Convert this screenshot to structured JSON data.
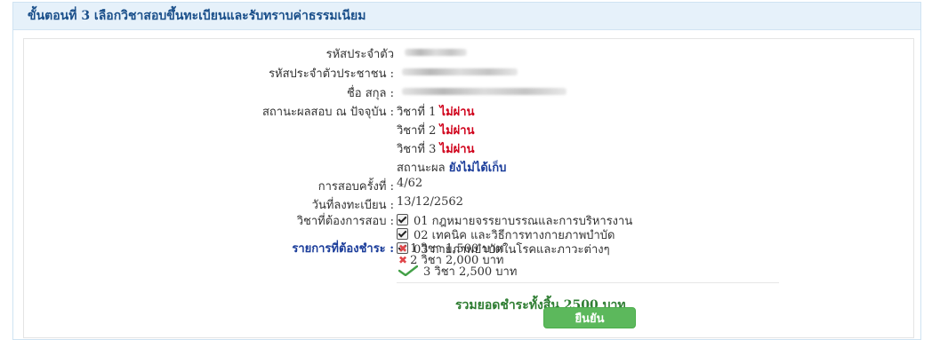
{
  "header": {
    "title": "ขั้นตอนที่ 3 เลือกวิชาสอบขึ้นทะเบียนและรับทราบค่าธรรมเนียม"
  },
  "fields": {
    "student_id_label": "รหัสประจำตัว",
    "national_id_label": "รหัสประจำตัวประชาชน :",
    "name_label": "ชื่อ สกุล :",
    "exam_status_label": "สถานะผลสอบ ณ ปัจจุบัน :",
    "subject1_prefix": "วิชาที่ 1",
    "subject1_status": "ไม่ผ่าน",
    "subject2_prefix": "วิชาที่ 2",
    "subject2_status": "ไม่ผ่าน",
    "subject3_prefix": "วิชาที่ 3",
    "subject3_status": "ไม่ผ่าน",
    "result_prefix": "สถานะผล",
    "result_status": "ยังไม่ได้เก็บ",
    "exam_round_label": "การสอบครั้งที่ :",
    "exam_round_value": "4/62",
    "reg_date_label": "วันที่ลงทะเบียน :",
    "reg_date_value": "13/12/2562",
    "subjects_label": "วิชาที่ต้องการสอบ :"
  },
  "subjects": [
    "01 กฎหมายจรรยาบรรณและการบริหารงาน",
    "02 เทคนิค และวิธีการทางกายภาพบำบัด",
    "03 กายภาพบำบัดในโรคและภาวะต่างๆ"
  ],
  "payment": {
    "label": "รายการที่ต้องชำระ :",
    "options": [
      {
        "text": "1 วิชา 1,500 บาท",
        "selected": false
      },
      {
        "text": "2 วิชา 2,000 บาท",
        "selected": false
      },
      {
        "text": "3 วิชา 2,500 บาท",
        "selected": true
      }
    ],
    "total": "รวมยอดชำระทั้งสิ้น 2500 บาท"
  },
  "confirm_button": "ยืนยัน",
  "colors": {
    "fail": "#d0021b",
    "status_blue": "#1a3c9a",
    "total_green": "#2e7d32",
    "button_green": "#5cb85c"
  }
}
